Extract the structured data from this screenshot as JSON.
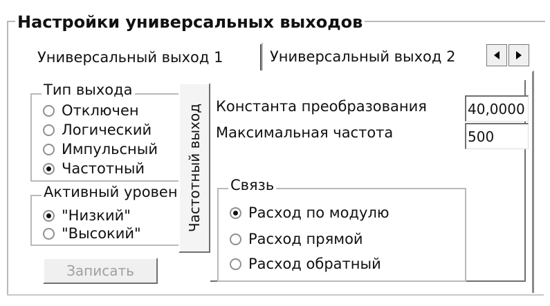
{
  "window": {
    "title": "Настройки универсальных выходов"
  },
  "tabs": [
    {
      "label": "Универсальный выход 1",
      "active": true
    },
    {
      "label": "Универсальный выход 2",
      "active": false
    }
  ],
  "tab_scroll": {
    "left_icon": "arrow-left-icon",
    "right_icon": "arrow-right-icon"
  },
  "output_type": {
    "title": "Тип выхода",
    "options": [
      {
        "label": "Отключен",
        "checked": false
      },
      {
        "label": "Логический",
        "checked": false
      },
      {
        "label": "Импульсный",
        "checked": false
      },
      {
        "label": "Частотный",
        "checked": true
      }
    ]
  },
  "active_level": {
    "title": "Активный уровень",
    "options": [
      {
        "label": "\"Низкий\"",
        "checked": true
      },
      {
        "label": "\"Высокий\"",
        "checked": false
      }
    ]
  },
  "write_button": {
    "label": "Записать",
    "enabled": false
  },
  "vertical_tab": {
    "label": "Частотный выход"
  },
  "fields": {
    "conversion_constant": {
      "label": "Константа преобразования",
      "value": "40,0000"
    },
    "max_frequency": {
      "label": "Максимальная частота",
      "value": "500"
    }
  },
  "link": {
    "title": "Связь",
    "options": [
      {
        "label": "Расход по модулю",
        "checked": true
      },
      {
        "label": "Расход прямой",
        "checked": false
      },
      {
        "label": "Расход обратный",
        "checked": false
      }
    ]
  }
}
